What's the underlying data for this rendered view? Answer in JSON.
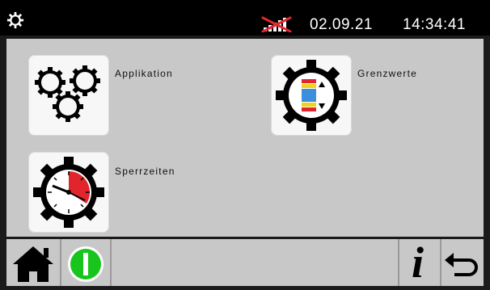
{
  "status_bar": {
    "date": "02.09.21",
    "time": "14:34:41",
    "settings_icon": "gear-icon",
    "signal_icon": "no-signal-icon"
  },
  "menu": {
    "items": [
      {
        "label": "Applikation",
        "icon": "three-gears-icon"
      },
      {
        "label": "Grenzwerte",
        "icon": "gear-with-limits-icon"
      },
      {
        "label": "Sperrzeiten",
        "icon": "gear-with-clock-icon"
      }
    ]
  },
  "bottom_bar": {
    "home_icon": "home-icon",
    "power_icon": "power-icon",
    "info_icon": "info-icon",
    "info_glyph": "i",
    "back_icon": "back-arrow-icon"
  },
  "colors": {
    "status_bar_bg": "#000000",
    "panel_bg": "#c8c8c8",
    "tile_bg": "#f7f7f7",
    "power_green": "#17c51d",
    "limit_red": "#e0252c",
    "limit_yellow": "#f1d21a",
    "limit_blue": "#3b8fdd",
    "signal_red": "#e3262c"
  }
}
